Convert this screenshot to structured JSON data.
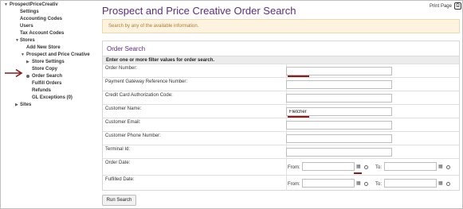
{
  "sidebar": {
    "root": "ProspectPriceCreativ",
    "items": [
      {
        "label": "Settings"
      },
      {
        "label": "Accounting Codes"
      },
      {
        "label": "Users"
      },
      {
        "label": "Tax Account Codes"
      },
      {
        "label": "Stores"
      },
      {
        "label": "Add New Store"
      },
      {
        "label": "Prospect and Price Creative"
      },
      {
        "label": "Store Settings"
      },
      {
        "label": "Store Copy"
      },
      {
        "label": "Order Search"
      },
      {
        "label": "Fulfill Orders"
      },
      {
        "label": "Refunds"
      },
      {
        "label": "GL Exceptions (0)"
      },
      {
        "label": "Sites"
      }
    ]
  },
  "header": {
    "title": "Prospect and Price Creative Order Search",
    "print_label": "Print Page"
  },
  "notice": "Search by any of the available information.",
  "panel": {
    "title": "Order Search",
    "subtitle": "Enter one or more filter values for order search.",
    "fields": [
      {
        "label": "Order Number:",
        "value": ""
      },
      {
        "label": "Payment Gateway Reference Number:",
        "value": ""
      },
      {
        "label": "Credit Card Authorization Code:",
        "value": ""
      },
      {
        "label": "Customer Name:",
        "value": "Fletcher"
      },
      {
        "label": "Customer Email:",
        "value": ""
      },
      {
        "label": "Customer Phone Number:",
        "value": ""
      },
      {
        "label": "Terminal Id:",
        "value": ""
      }
    ],
    "date_fields": [
      {
        "label": "Order Date:",
        "from_label": "From:",
        "to_label": "To:"
      },
      {
        "label": "Fulfilled Date:",
        "from_label": "From:",
        "to_label": "To:"
      }
    ]
  },
  "buttons": {
    "run_search": "Run Search"
  },
  "colors": {
    "title": "#5a2d82",
    "notice_bg": "#fdf3df",
    "notice_text": "#b07a32",
    "annotation": "#8b1a1a"
  }
}
